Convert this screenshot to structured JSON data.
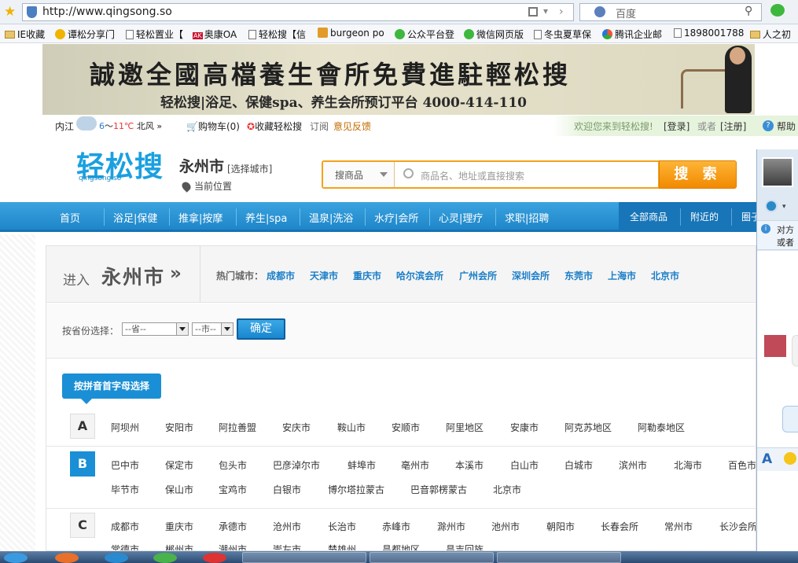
{
  "browser": {
    "url": "http://www.qingsong.so",
    "search_placeholder": "百度",
    "bookmarks": [
      "IE收藏",
      "谭松分享门",
      "轻松置业【",
      "奥康OA",
      "轻松搜【信",
      "burgeon po",
      "公众平台登",
      "微信网页版",
      "冬虫夏草保",
      "腾讯企业邮",
      "1898001788",
      "人之初"
    ],
    "bookmark_badge": "AK"
  },
  "banner": {
    "headline": "誠邀全國高檔養生會所免費進駐輕松搜",
    "tagline": "轻松搜|浴足、保健spa、养生会所预订平台  4000-414-110"
  },
  "topbar": {
    "city": "内江",
    "temp_low": "6",
    "temp_high": "11℃",
    "wind": "北风 »",
    "temp_sep": "～",
    "cart": "购物车(0)",
    "favorite": "收藏轻松搜",
    "subscribe": "订阅",
    "feedback": "意见反馈",
    "welcome": "欢迎您来到轻松搜!",
    "login": "[登录]",
    "or": "或者",
    "register": "[注册]",
    "help": "帮助"
  },
  "header": {
    "logo": "轻松搜",
    "logo_sub": "qingsong.so",
    "current_city": "永州市",
    "select_city": "[选择城市]",
    "current_position": "当前位置",
    "search_category": "搜商品",
    "search_placeholder": "商品名、地址或直接搜索",
    "search_button": "搜 索"
  },
  "nav": {
    "items": [
      "首页",
      "浴足|保健",
      "推拿|按摩",
      "养生|spa",
      "温泉|洗浴",
      "水疗|会所",
      "心灵|理疗",
      "求职|招聘"
    ],
    "right_items": [
      "全部商品",
      "附近的",
      "圈子"
    ]
  },
  "enter": {
    "label": "进入",
    "city": "永州市",
    "arrow": "»",
    "hot_label": "热门城市：",
    "hot_cities": [
      "成都市",
      "天津市",
      "重庆市",
      "哈尔滨会所",
      "广州会所",
      "深圳会所",
      "东莞市",
      "上海市",
      "北京市"
    ]
  },
  "province": {
    "label": "按省份选择：",
    "province_value": "--省--",
    "city_value": "--市--",
    "ok": "确定"
  },
  "pinyin": {
    "button": "按拼音首字母选择",
    "groups": [
      {
        "letter": "A",
        "rows": [
          [
            "阿坝州",
            "安阳市",
            "阿拉善盟",
            "安庆市",
            "鞍山市",
            "安顺市",
            "阿里地区",
            "安康市",
            "阿克苏地区",
            "阿勒泰地区"
          ]
        ]
      },
      {
        "letter": "B",
        "rows": [
          [
            "巴中市",
            "保定市",
            "包头市",
            "巴彦淖尔市",
            "蚌埠市",
            "亳州市",
            "本溪市",
            "白山市",
            "白城市",
            "滨州市",
            "北海市",
            "百色市"
          ],
          [
            "毕节市",
            "保山市",
            "宝鸡市",
            "白银市",
            "博尔塔拉蒙古",
            "巴音郭楞蒙古",
            "北京市"
          ]
        ]
      },
      {
        "letter": "C",
        "rows": [
          [
            "成都市",
            "重庆市",
            "承德市",
            "沧州市",
            "长治市",
            "赤峰市",
            "滁州市",
            "池州市",
            "朝阳市",
            "长春会所",
            "常州市",
            "长沙会所"
          ],
          [
            "常德市",
            "郴州市",
            "潮州市",
            "崇左市",
            "楚雄州",
            "昌都地区",
            "昌吉回族"
          ]
        ]
      }
    ]
  },
  "chat": {
    "warn_line1": "对方",
    "warn_line2": "或者",
    "font_icon": "A"
  }
}
